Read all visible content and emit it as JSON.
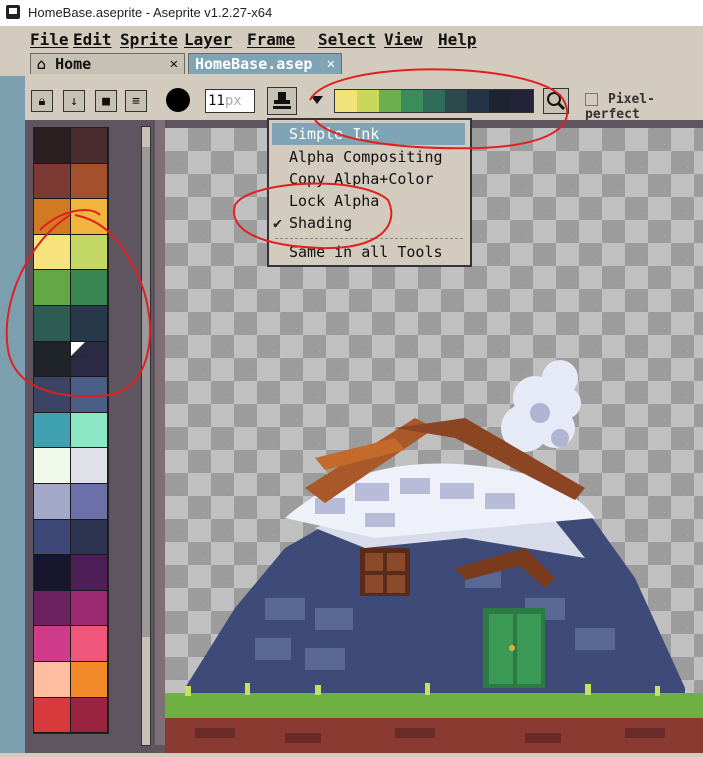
{
  "window": {
    "title": "HomeBase.aseprite - Aseprite v1.2.27-x64"
  },
  "menu": [
    "File",
    "Edit",
    "Sprite",
    "Layer",
    "Frame",
    "Select",
    "View",
    "Help"
  ],
  "tabs": [
    {
      "label": "Home",
      "icon": "home-icon"
    },
    {
      "label": "HomeBase.asep",
      "icon": ""
    }
  ],
  "toolbar": {
    "brush_size": "11",
    "brush_unit": "px",
    "pixel_perfect": "Pixel-perfect",
    "shade_colors": [
      "#f0e37a",
      "#c9d85a",
      "#6ab04c",
      "#3a8c5a",
      "#2e6b59",
      "#2c4a4c",
      "#243447",
      "#1d2430",
      "#23223a"
    ]
  },
  "ink_menu": {
    "items": [
      "Simple Ink",
      "Alpha Compositing",
      "Copy Alpha+Color",
      "Lock Alpha",
      "Shading",
      "Same in all Tools"
    ],
    "selected": "Simple Ink",
    "checked": "Shading"
  },
  "palette": {
    "colors": [
      "#2b1f22",
      "#4a2b30",
      "#7d3a32",
      "#a5502c",
      "#d17a22",
      "#f2b43c",
      "#f6e37d",
      "#c4d865",
      "#62a844",
      "#3a8653",
      "#2d5c54",
      "#26384a",
      "#1f2428",
      "#2b2a44",
      "#3b4465",
      "#4b5f86",
      "#3ea0b0",
      "#8ce8c4",
      "#f1faea",
      "#dfe0e8",
      "#a4a8c8",
      "#6b70a8",
      "#3d4877",
      "#2d3452",
      "#16172c",
      "#4e1f56",
      "#6d2260",
      "#9c2a72",
      "#cf3d8a",
      "#f0557a",
      "#ffbea0",
      "#f28a2a",
      "#d63a3a",
      "#9a2440"
    ]
  },
  "colors": {
    "accent": "#7ea4b6",
    "panel": "#d3cbbe",
    "annotation": "#e02020"
  }
}
